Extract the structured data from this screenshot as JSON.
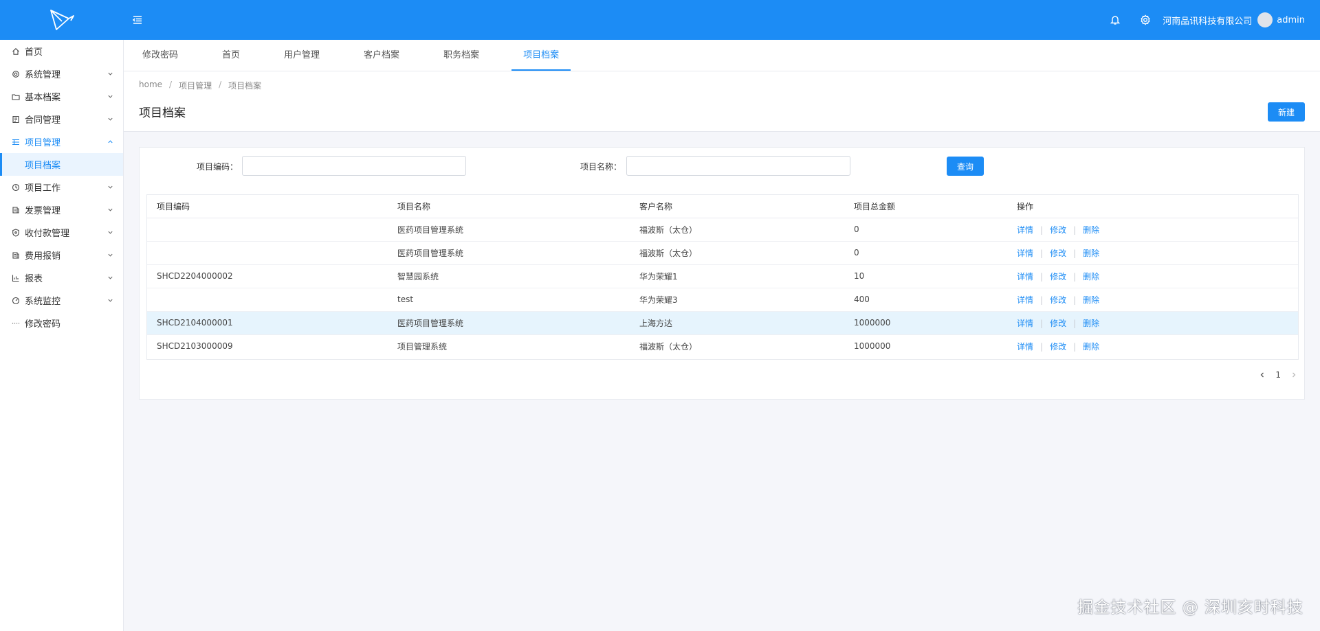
{
  "header": {
    "company": "河南品讯科技有限公司",
    "username": "admin"
  },
  "sidebar": {
    "items": [
      {
        "label": "首页",
        "icon": "home-icon"
      },
      {
        "label": "系统管理",
        "icon": "gear-icon"
      },
      {
        "label": "基本档案",
        "icon": "folder-icon"
      },
      {
        "label": "合同管理",
        "icon": "contract-icon"
      },
      {
        "label": "项目管理",
        "icon": "list-icon"
      },
      {
        "label": "项目工作",
        "icon": "clock-icon"
      },
      {
        "label": "发票管理",
        "icon": "invoice-icon"
      },
      {
        "label": "收付款管理",
        "icon": "shield-icon"
      },
      {
        "label": "费用报销",
        "icon": "receipt-icon"
      },
      {
        "label": "报表",
        "icon": "chart-icon"
      },
      {
        "label": "系统监控",
        "icon": "gauge-icon"
      },
      {
        "label": "修改密码",
        "icon": "dots-icon"
      }
    ],
    "sub_item": "项目档案"
  },
  "tabs": [
    "修改密码",
    "首页",
    "用户管理",
    "客户档案",
    "职务档案",
    "项目档案"
  ],
  "breadcrumb": [
    "home",
    "项目管理",
    "项目档案"
  ],
  "page_title": "项目档案",
  "new_button": "新建",
  "search": {
    "code_label": "项目编码：",
    "name_label": "项目名称：",
    "code_value": "",
    "name_value": "",
    "query_button": "查询"
  },
  "table": {
    "columns": [
      "项目编码",
      "项目名称",
      "客户名称",
      "项目总金额",
      "操作"
    ],
    "rows": [
      {
        "code": "",
        "name": "医药项目管理系统",
        "customer": "福波斯（太仓）",
        "amount": "0"
      },
      {
        "code": "",
        "name": "医药项目管理系统",
        "customer": "福波斯（太仓）",
        "amount": "0"
      },
      {
        "code": "SHCD2204000002",
        "name": "智慧园系统",
        "customer": "华为荣耀1",
        "amount": "10"
      },
      {
        "code": "",
        "name": "test",
        "customer": "华为荣耀3",
        "amount": "400"
      },
      {
        "code": "SHCD2104000001",
        "name": "医药项目管理系统",
        "customer": "上海方达",
        "amount": "1000000"
      },
      {
        "code": "SHCD2103000009",
        "name": "项目管理系统",
        "customer": "福波斯（太仓）",
        "amount": "1000000"
      }
    ],
    "ops": {
      "detail": "详情",
      "edit": "修改",
      "delete": "删除"
    }
  },
  "pager": {
    "current": "1"
  },
  "watermark": "掘金技术社区 @ 深圳亥时科技"
}
